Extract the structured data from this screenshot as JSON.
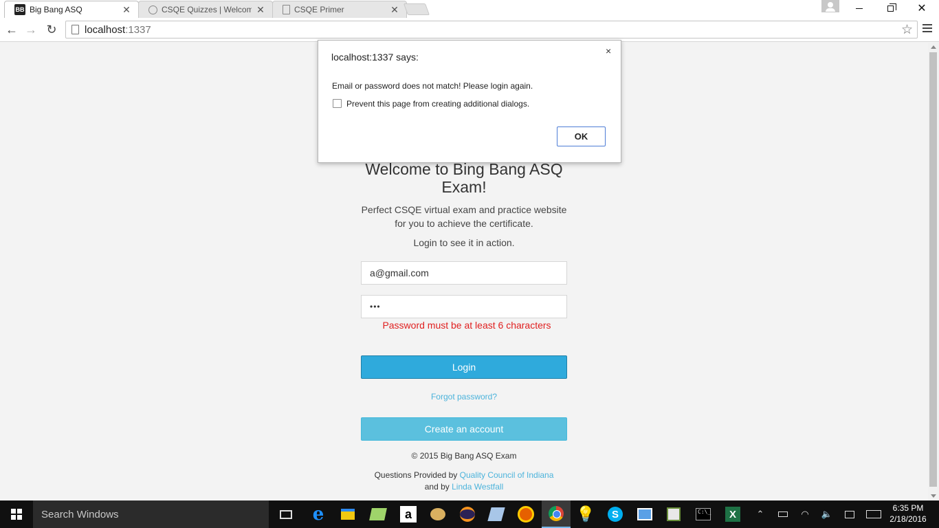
{
  "browser": {
    "tabs": [
      {
        "title": "Big Bang ASQ",
        "favicon": "BB",
        "active": true
      },
      {
        "title": "CSQE Quizzes | Welcome t",
        "active": false
      },
      {
        "title": "CSQE Primer",
        "active": false
      }
    ],
    "url_host": "localhost",
    "url_port": ":1337"
  },
  "page": {
    "welcome": "Welcome to Bing Bang ASQ Exam!",
    "intro": "Perfect CSQE virtual exam and practice website for you to achieve the certificate.",
    "login_prompt": "Login to see it in action.",
    "email_value": "a@gmail.com",
    "password_value": "•••",
    "password_error": "Password must be at least 6 characters",
    "login_label": "Login",
    "forgot_label": "Forgot password?",
    "create_label": "Create an account",
    "copyright": "© 2015 Big Bang ASQ Exam",
    "credits_prefix": "Questions Provided by ",
    "credits_link1": "Quality Council of Indiana",
    "credits_mid": "and by ",
    "credits_link2": "Linda Westfall",
    "link_color": "#4bb3db",
    "login_button_color": "#2faadc",
    "create_button_color": "#5bc0de",
    "error_color": "#e02020"
  },
  "dialog": {
    "title": "localhost:1337 says:",
    "message": "Email or password does not match! Please login again.",
    "checkbox_label": "Prevent this page from creating additional dialogs.",
    "ok_label": "OK",
    "close_glyph": "×"
  },
  "taskbar": {
    "search_placeholder": "Search Windows",
    "time": "6:35 PM",
    "date": "2/18/2016",
    "amazon_glyph": "a",
    "skype_glyph": "S",
    "excel_glyph": "X",
    "cmd_glyph": "C:\\_"
  }
}
